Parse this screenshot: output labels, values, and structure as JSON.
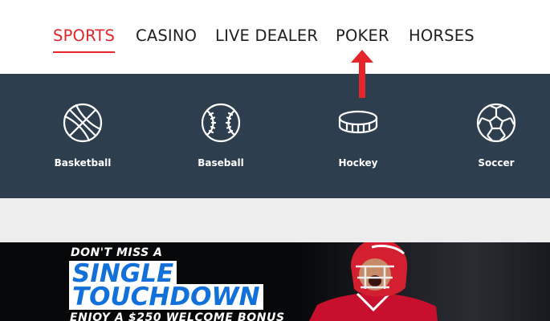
{
  "nav": {
    "tabs": [
      {
        "label": "SPORTS",
        "active": true
      },
      {
        "label": "CASINO",
        "active": false
      },
      {
        "label": "LIVE DEALER",
        "active": false
      },
      {
        "label": "POKER",
        "active": false
      },
      {
        "label": "HORSES",
        "active": false
      }
    ],
    "accent_color": "#e4262b"
  },
  "sports": {
    "items": [
      {
        "label": "Basketball",
        "icon": "basketball-icon"
      },
      {
        "label": "Baseball",
        "icon": "baseball-icon"
      },
      {
        "label": "Hockey",
        "icon": "hockey-puck-icon"
      },
      {
        "label": "Soccer",
        "icon": "soccer-ball-icon"
      }
    ],
    "background": "#2d3e4e"
  },
  "promo": {
    "tagline": "DON'T MISS A",
    "headline_1": "SINGLE",
    "headline_2": "TOUCHDOWN",
    "subline": "ENJOY A $250 WELCOME BONUS",
    "accent_color": "#1170d9"
  }
}
